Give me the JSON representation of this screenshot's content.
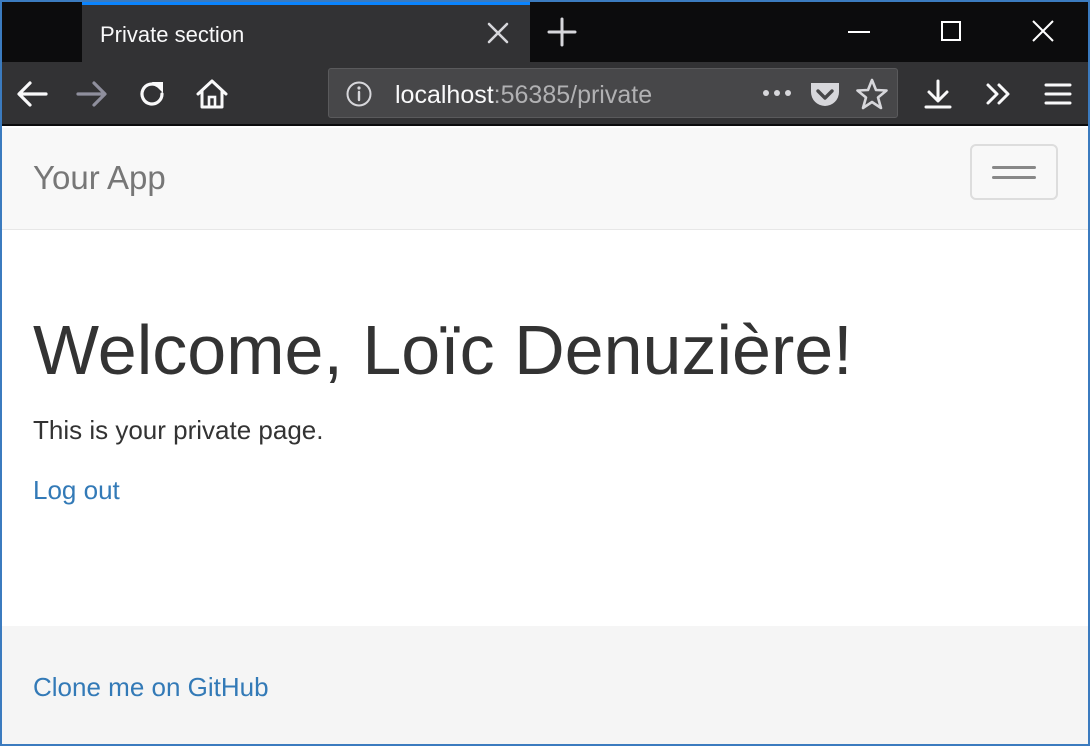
{
  "browser": {
    "tab_title": "Private section",
    "url": {
      "host": "localhost",
      "rest": ":56385/private"
    },
    "icons": {
      "tab_close": "close-icon",
      "new_tab": "plus-icon",
      "minimize": "minimize-icon",
      "maximize": "maximize-icon",
      "close_window": "close-icon",
      "back": "back-arrow-icon",
      "forward": "forward-arrow-icon",
      "reload": "reload-icon",
      "home": "home-icon",
      "site_info": "info-icon",
      "page_actions": "more-dots-icon",
      "pocket": "pocket-icon",
      "bookmark": "star-icon",
      "downloads": "download-icon",
      "overflow": "double-chevron-icon",
      "menu": "hamburger-icon"
    },
    "colors": {
      "chrome_dark": "#0c0c0d",
      "toolbar": "#323234",
      "tab_accent": "#0a84ff",
      "window_border": "#3b7bbf"
    }
  },
  "app": {
    "brand": "Your App",
    "heading": "Welcome, Loïc Denuzière!",
    "intro": "This is your private page.",
    "logout_label": "Log out",
    "footer_link": "Clone me on GitHub",
    "colors": {
      "link": "#337ab7",
      "text": "#333333",
      "brand": "#777777",
      "navbar_bg": "#f8f8f8",
      "footer_bg": "#f5f5f5"
    }
  }
}
